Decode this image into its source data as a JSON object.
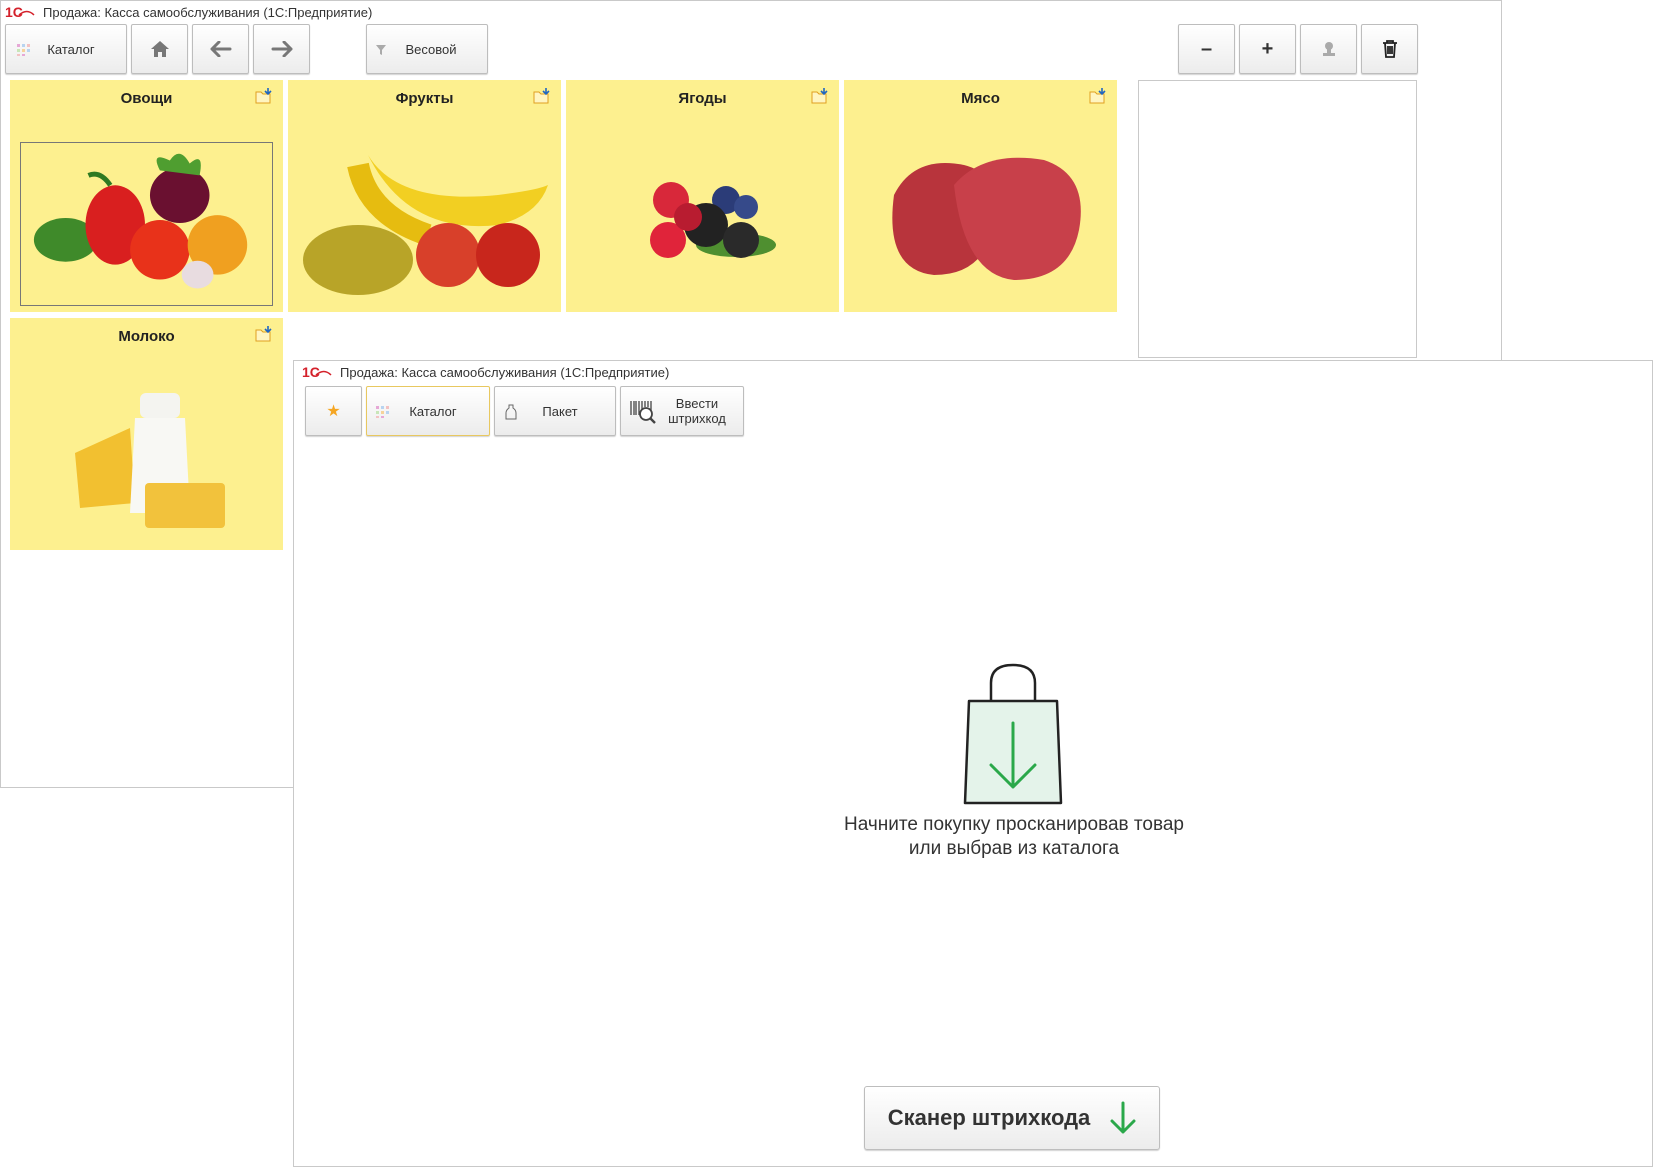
{
  "back_window": {
    "title": "Продажа: Касса самообслуживания  (1С:Предприятие)",
    "toolbar": {
      "catalog_label": "Каталог",
      "filter_label": "Весовой"
    },
    "tiles": [
      {
        "name": "Овощи"
      },
      {
        "name": "Фрукты"
      },
      {
        "name": "Ягоды"
      },
      {
        "name": "Мясо"
      },
      {
        "name": "Молоко"
      }
    ]
  },
  "front_window": {
    "title": "Продажа: Касса самообслуживания  (1С:Предприятие)",
    "toolbar": {
      "catalog_label": "Каталог",
      "bag_label": "Пакет",
      "barcode_label": "Ввести\nштрихкод"
    },
    "empty_state": {
      "line1": "Начните покупку просканировав товар",
      "line2": "или выбрав из каталога"
    },
    "scanner_button_label": "Сканер штрихкода"
  },
  "colors": {
    "tile_bg": "#fdf08f",
    "accent_green": "#2aa84a",
    "logo_red": "#d4212b",
    "star": "#f5a623"
  }
}
